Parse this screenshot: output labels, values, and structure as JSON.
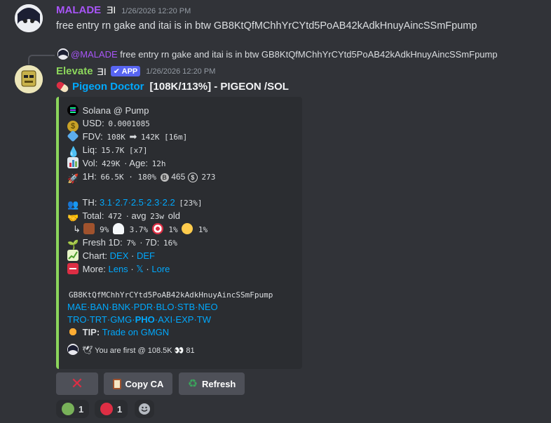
{
  "msg1": {
    "username": "MALADE",
    "timestamp": "1/26/2026 12:20 PM",
    "text": "free entry rn gake and itai is in btw GB8KtQfMChhYrCYtd5PoAB42kAdkHnuyAincSSmFpump",
    "username_color": "#a855f7"
  },
  "reply": {
    "mention": "@MALADE",
    "text": "free entry rn gake and itai is in btw GB8KtQfMChhYrCYtd5PoAB42kAdkHnuyAincSSmFpump"
  },
  "msg2": {
    "username": "Elevate",
    "badge": "APP",
    "timestamp": "1/26/2026 12:20 PM",
    "username_color": "#8cd65c",
    "title_link": "Pigeon Doctor",
    "title_rest": "[108K/113%] - PIGEON /SOL"
  },
  "embed": {
    "chain": "Solana @ Pump",
    "usd_label": "USD:",
    "usd_value": "0.0001085",
    "fdv_label": "FDV:",
    "fdv_from": "108K",
    "fdv_arrow": "➡",
    "fdv_to": "142K [16m]",
    "liq_label": "Liq:",
    "liq_value": "15.7K [x7]",
    "vol_label": "Vol:",
    "vol_value": "429K",
    "age_label": "· Age:",
    "age_value": "12h",
    "h1_label": "1H:",
    "h1_value": "66.5K · 180%",
    "h1_buys": "465",
    "h1_sells": "273",
    "th_label": "TH:",
    "th_links": [
      "3.1",
      "2.7",
      "2.5",
      "2.3",
      "2.2"
    ],
    "th_total": "[23%]",
    "total_label": "Total:",
    "total_value": "472",
    "avg_label": "· avg",
    "avg_value": "23w",
    "avg_suffix": "old",
    "dist": [
      {
        "icon": "box-icon",
        "value": "9%"
      },
      {
        "icon": "ghost-icon",
        "value": "3.7%"
      },
      {
        "icon": "target-icon",
        "value": "1%"
      },
      {
        "icon": "person-icon",
        "value": "1%"
      }
    ],
    "fresh_label": "Fresh 1D:",
    "fresh_1d": "7%",
    "fresh_7d_label": "· 7D:",
    "fresh_7d": "16%",
    "chart_label": "Chart:",
    "chart_links": [
      "DEX",
      "DEF"
    ],
    "more_label": "More:",
    "more_links": [
      "Lens",
      "𝕏",
      "Lore"
    ],
    "ca": "GB8KtQfMChhYrCYtd5PoAB42kAdkHnuyAincSSmFpump",
    "exchanges_row1": [
      "MAE",
      "BAN",
      "BNK",
      "PDR",
      "BLO",
      "STB",
      "NEO"
    ],
    "exchanges_row2": [
      "TRO",
      "TRT",
      "GMG",
      "PHO",
      "AXI",
      "EXP",
      "TW"
    ],
    "tip_label": "TIP:",
    "tip_link": "Trade on GMGN",
    "footer_text": "You are first @ 108.5K",
    "footer_count": "81",
    "accent": "#8cd65c"
  },
  "buttons": {
    "close_label": "",
    "copy_label": "Copy CA",
    "refresh_label": "Refresh"
  },
  "reactions": [
    {
      "icon": "green-circle-icon",
      "count": "1",
      "color": "#78b159"
    },
    {
      "icon": "red-circle-icon",
      "count": "1",
      "color": "#dd2e44"
    }
  ]
}
